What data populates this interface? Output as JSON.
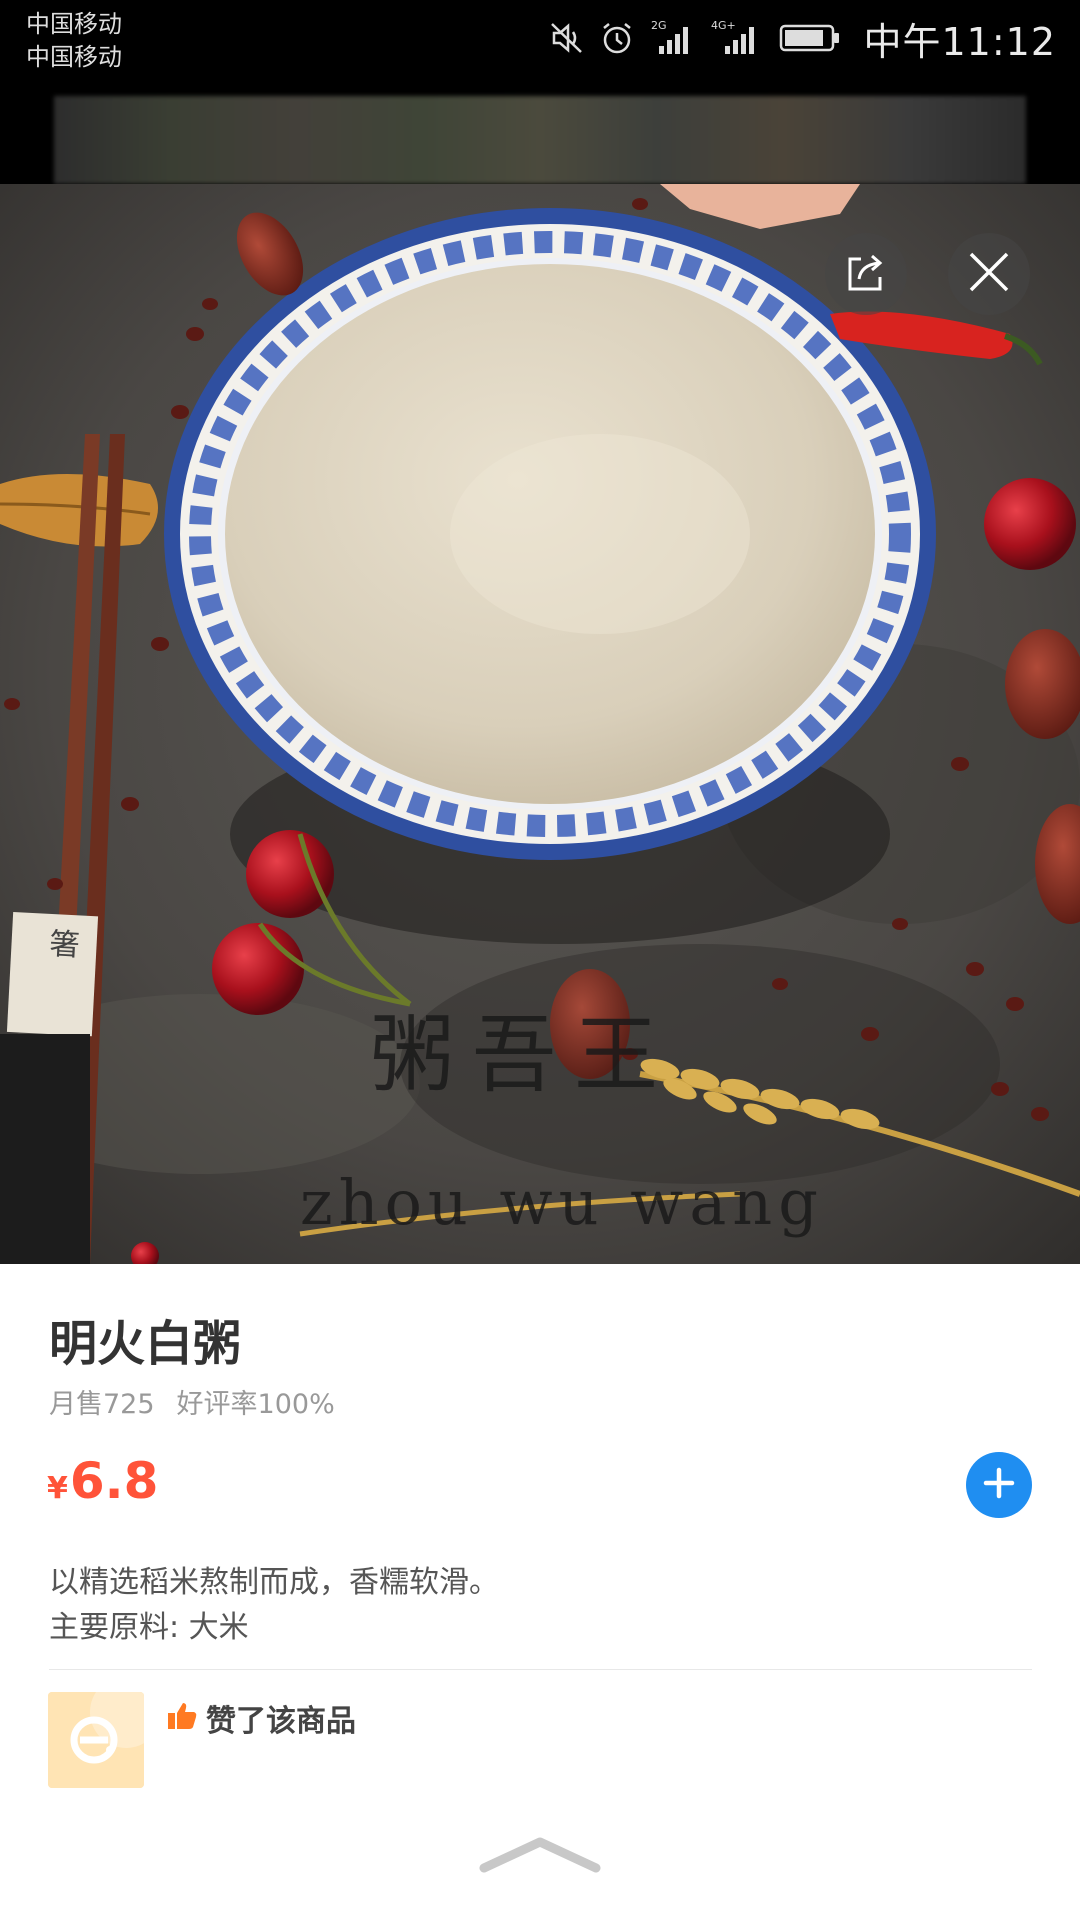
{
  "status_bar": {
    "carrier_line1": "中国移动",
    "carrier_line2": "中国移动",
    "net_label_1": "2G",
    "net_label_2": "4G+",
    "time": "中午11:12",
    "icons": [
      "mute-icon",
      "alarm-icon",
      "signal-icon",
      "battery-icon"
    ]
  },
  "hero": {
    "handwriting_cn": "粥吾王",
    "handwriting_en": "zhou wu wang",
    "buttons": [
      "share-icon",
      "close-icon"
    ]
  },
  "product": {
    "name": "明火白粥",
    "monthly_sales": "月售725",
    "rating": "好评率100%",
    "currency": "¥",
    "price": "6.8",
    "description_line1": "以精选稻米熬制而成，香糯软滑。",
    "description_line2": "主要原料: 大米",
    "like_text": "赞了该商品"
  },
  "colors": {
    "price": "#ff5339",
    "add_button": "#1f8ef1",
    "like_icon": "#ff7a22",
    "avatar_bg": "#ffe4b4"
  }
}
